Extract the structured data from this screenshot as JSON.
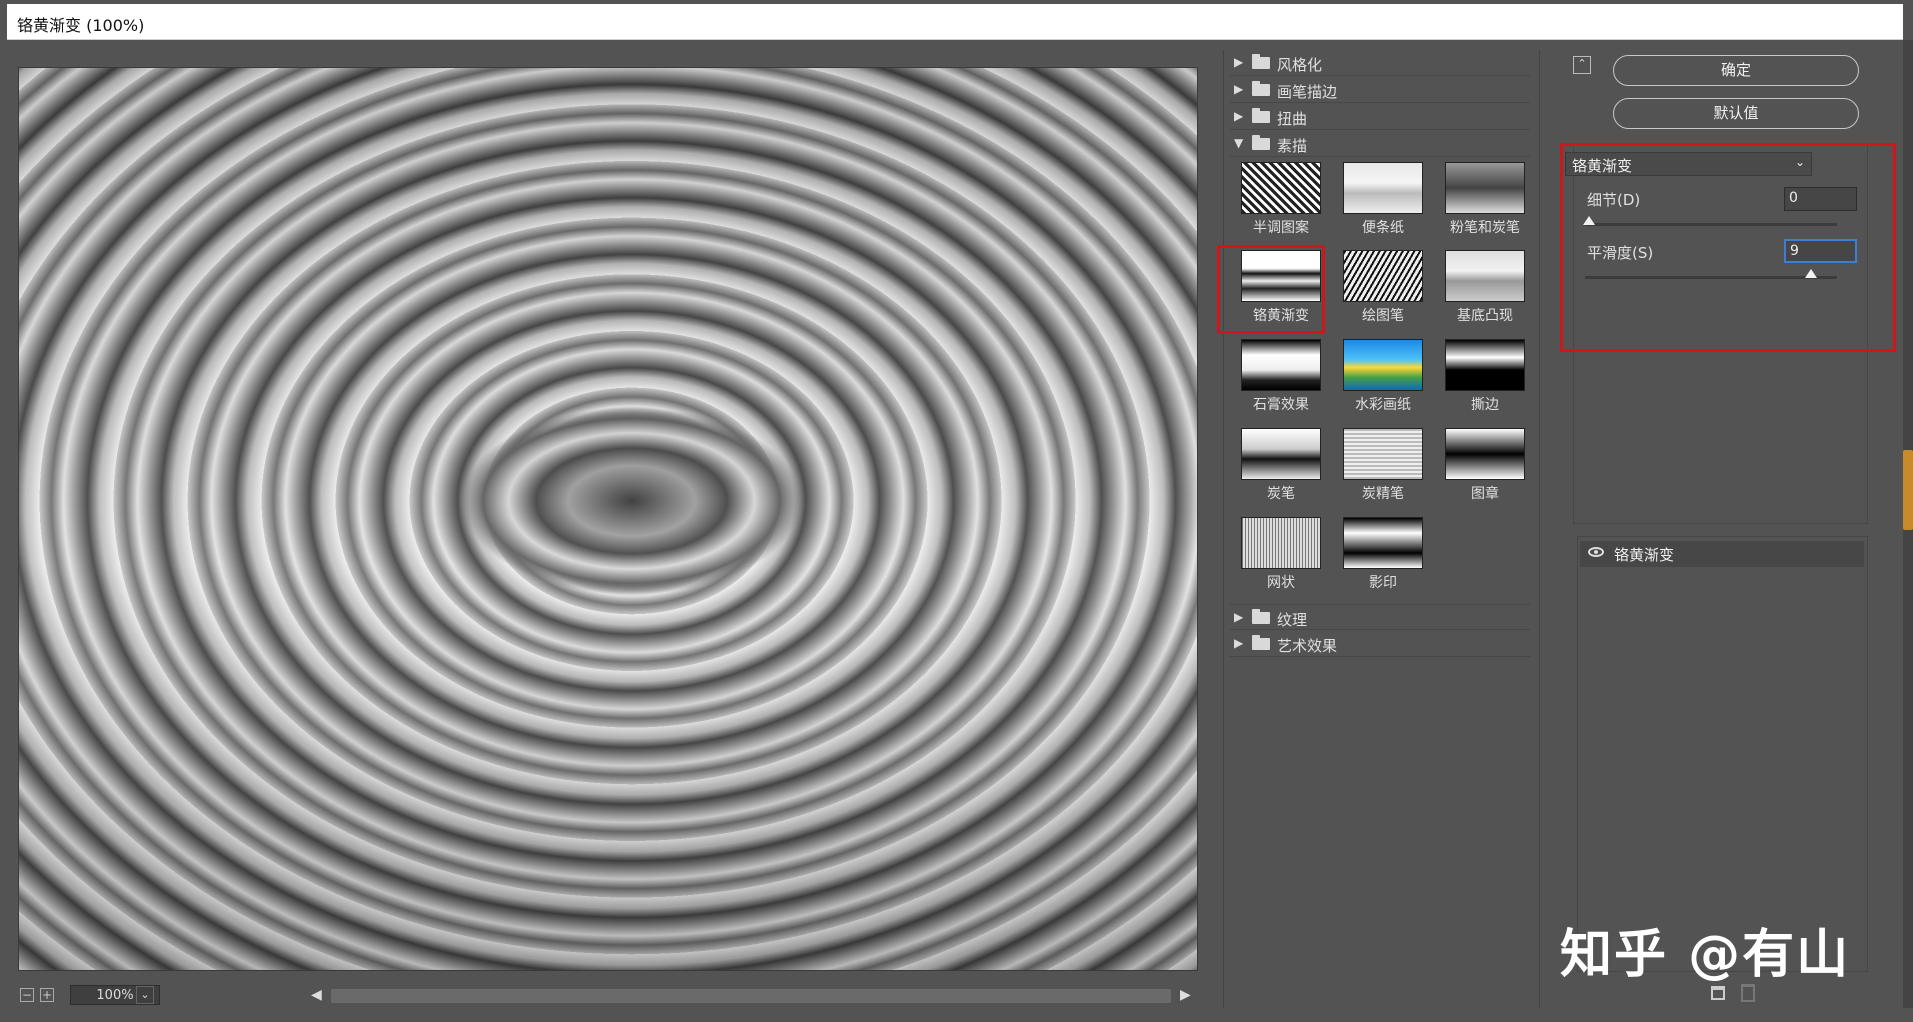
{
  "window": {
    "title": "铬黄渐变 (100%)"
  },
  "preview": {
    "zoom": "100%"
  },
  "gallery": {
    "folders_top": [
      "风格化",
      "画笔描边",
      "扭曲"
    ],
    "open_folder": "素描",
    "thumbnails": [
      "半调图案",
      "便条纸",
      "粉笔和炭笔",
      "铬黄渐变",
      "绘图笔",
      "基底凸现",
      "石膏效果",
      "水彩画纸",
      "撕边",
      "炭笔",
      "炭精笔",
      "图章",
      "网状",
      "影印"
    ],
    "folders_bottom": [
      "纹理",
      "艺术效果"
    ]
  },
  "settings": {
    "ok_label": "确定",
    "default_label": "默认值",
    "filter_select": "铬黄渐变",
    "detail_label": "细节(D)",
    "detail_value": "0",
    "smooth_label": "平滑度(S)",
    "smooth_value": "9"
  },
  "layers": {
    "row_label": "铬黄渐变"
  },
  "watermark": "知乎 @有山",
  "colors": {
    "highlight": "#d0161d",
    "focus": "#3c7fd0",
    "background": "#535353"
  }
}
